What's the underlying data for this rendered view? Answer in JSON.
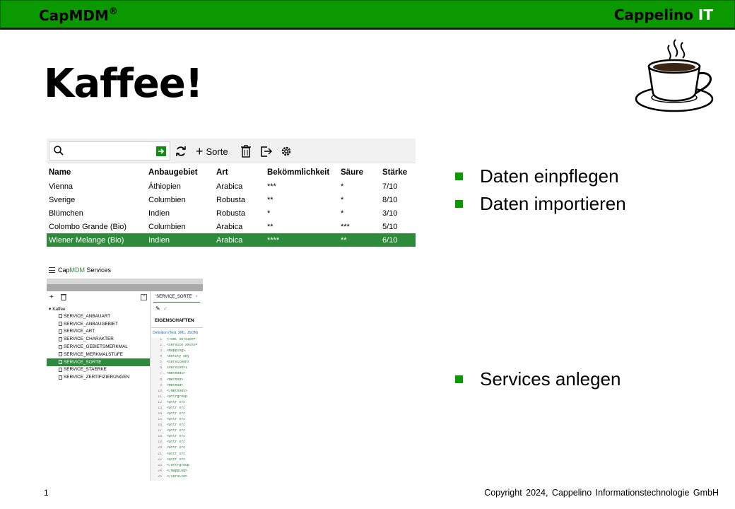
{
  "header": {
    "brand_left_prefix": "Cap",
    "brand_left_bold": "MDM",
    "brand_left_reg": "®",
    "brand_right_main": "Cappelino ",
    "brand_right_accent": "IT",
    "colors": {
      "bar": "#0a9a00",
      "accent": "#2e8b3c"
    }
  },
  "slide": {
    "title": "Kaffee!",
    "cup_icon": "coffee-cup-icon"
  },
  "grid": {
    "search": {
      "value": "",
      "placeholder": ""
    },
    "toolbar": {
      "add_label": "Sorte"
    },
    "columns": [
      "Name",
      "Anbaugebiet",
      "Art",
      "Bekömmlichkeit",
      "Säure",
      "Stärke"
    ],
    "rows": [
      [
        "Vienna",
        "Äthiopien",
        "Arabica",
        "***",
        "*",
        "7/10"
      ],
      [
        "Sverige",
        "Columbien",
        "Robusta",
        "**",
        "*",
        "8/10"
      ],
      [
        "Blümchen",
        "Indien",
        "Robusta",
        "*",
        "*",
        "3/10"
      ],
      [
        "Colombo Grande (Bio)",
        "Columbien",
        "Arabica",
        "**",
        "***",
        "5/10"
      ],
      [
        "Wiener Melange (Bio)",
        "Indien",
        "Arabica",
        "****",
        "**",
        "6/10"
      ]
    ],
    "selected_row": 4
  },
  "services": {
    "title_prefix": "Cap",
    "title_mdm": "MDM",
    "title_suffix": "Services",
    "tree_root": "Kaffee",
    "tree_items": [
      "SERVICE_ANBAUART",
      "SERVICE_ANBAUGEBIET",
      "SERVICE_ART",
      "SERVICE_CHARAKTER",
      "SERVICE_GEBIETSMERKMAL",
      "SERVICE_MERKMALSTUFE",
      "SERVICE_SORTE",
      "SERVICE_STAERKE",
      "SERVICE_ZERTIFIZIERUNGEN"
    ],
    "selected_item": 6,
    "editor": {
      "tab_label": "'SERVICE_SORTE'",
      "tab_close": "×",
      "properties_label": "EIGENSCHAFTEN",
      "definition_label": "Definition (Text, XML, JSON)",
      "code_lines": [
        {
          "n": "1",
          "f": "",
          "t": "<?xml version=\""
        },
        {
          "n": "2",
          "f": "⌄",
          "t": "<service xmlns="
        },
        {
          "n": "3",
          "f": "⌄",
          "t": "  <mapping>"
        },
        {
          "n": "4",
          "f": "",
          "t": "    <entity key"
        },
        {
          "n": "5",
          "f": "",
          "t": "    <serviceent"
        },
        {
          "n": "6",
          "f": "",
          "t": "    <version>1"
        },
        {
          "n": "7",
          "f": "⌄",
          "t": "    <methods>"
        },
        {
          "n": "8",
          "f": "",
          "t": "      <method>"
        },
        {
          "n": "9",
          "f": "",
          "t": "      <method>"
        },
        {
          "n": "10",
          "f": "",
          "t": "    </methods>"
        },
        {
          "n": "11",
          "f": "⌄",
          "t": "    <attrgroup"
        },
        {
          "n": "12",
          "f": "",
          "t": "      <attr src"
        },
        {
          "n": "13",
          "f": "",
          "t": "      <attr src"
        },
        {
          "n": "14",
          "f": "",
          "t": "      <attr src"
        },
        {
          "n": "15",
          "f": "",
          "t": "      <attr src"
        },
        {
          "n": "16",
          "f": "",
          "t": "      <attr src"
        },
        {
          "n": "17",
          "f": "",
          "t": "      <attr src"
        },
        {
          "n": "18",
          "f": "",
          "t": "      <attr src"
        },
        {
          "n": "19",
          "f": "",
          "t": "      <attr src"
        },
        {
          "n": "20",
          "f": "",
          "t": "      <attr src"
        },
        {
          "n": "21",
          "f": "",
          "t": "      <attr src"
        },
        {
          "n": "22",
          "f": "",
          "t": "      <attr src"
        },
        {
          "n": "23",
          "f": "",
          "t": "    </attrgroup"
        },
        {
          "n": "24",
          "f": "",
          "t": "  </mapping>"
        },
        {
          "n": "25",
          "f": "",
          "t": "</service>"
        }
      ]
    }
  },
  "bullets": [
    "Daten einpflegen",
    "Daten importieren",
    "Services anlegen"
  ],
  "footer": {
    "page": "1",
    "copyright": "Copyright 2024, Cappelino Informationstechnologie GmbH"
  }
}
